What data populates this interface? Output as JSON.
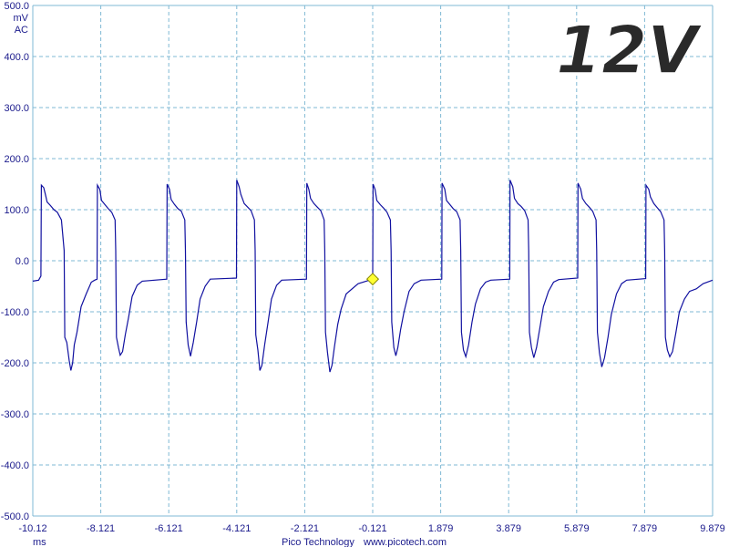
{
  "overlay_label": "12V",
  "footer": {
    "brand": "Pico Technology",
    "url": "www.picotech.com"
  },
  "colors": {
    "trace": "#1111a0",
    "grid": "#7fb8d4",
    "text": "#1a1a8c",
    "marker": "#ffff33",
    "background": "#ffffff"
  },
  "chart_data": {
    "type": "line",
    "title": "",
    "xlabel": "ms",
    "ylabel_lines": [
      "mV",
      "AC"
    ],
    "xlim": [
      -10.121,
      9.879
    ],
    "ylim": [
      -500,
      500
    ],
    "grid": true,
    "x_ticks": [
      "-10.12",
      "-8.121",
      "-6.121",
      "-4.121",
      "-2.121",
      "-0.121",
      "1.879",
      "3.879",
      "5.879",
      "7.879",
      "9.879"
    ],
    "y_ticks": [
      "500.0",
      "400.0",
      "300.0",
      "200.0",
      "100.0",
      "0.0",
      "-100.0",
      "-200.0",
      "-300.0",
      "-400.0",
      "-500.0"
    ],
    "trigger_marker": {
      "x": -0.121,
      "y": -36
    },
    "series": [
      {
        "points": [
          [
            -10.121,
            -40
          ],
          [
            -9.95,
            -38
          ],
          [
            -9.883,
            -30
          ],
          [
            -9.87,
            148
          ],
          [
            -9.8,
            143
          ],
          [
            -9.75,
            130
          ],
          [
            -9.7,
            115
          ],
          [
            -9.6,
            108
          ],
          [
            -9.5,
            100
          ],
          [
            -9.4,
            95
          ],
          [
            -9.28,
            80
          ],
          [
            -9.2,
            20
          ],
          [
            -9.18,
            -150
          ],
          [
            -9.12,
            -160
          ],
          [
            -9.05,
            -195
          ],
          [
            -9.0,
            -215
          ],
          [
            -8.95,
            -200
          ],
          [
            -8.9,
            -165
          ],
          [
            -8.82,
            -140
          ],
          [
            -8.7,
            -90
          ],
          [
            -8.55,
            -65
          ],
          [
            -8.4,
            -42
          ],
          [
            -8.3,
            -38
          ],
          [
            -8.23,
            -36
          ],
          [
            -8.22,
            148
          ],
          [
            -8.15,
            140
          ],
          [
            -8.1,
            118
          ],
          [
            -8.0,
            110
          ],
          [
            -7.9,
            102
          ],
          [
            -7.8,
            95
          ],
          [
            -7.7,
            80
          ],
          [
            -7.68,
            20
          ],
          [
            -7.66,
            -150
          ],
          [
            -7.6,
            -170
          ],
          [
            -7.55,
            -185
          ],
          [
            -7.48,
            -178
          ],
          [
            -7.4,
            -145
          ],
          [
            -7.3,
            -110
          ],
          [
            -7.2,
            -70
          ],
          [
            -7.05,
            -48
          ],
          [
            -6.9,
            -40
          ],
          [
            -6.18,
            -36
          ],
          [
            -6.17,
            150
          ],
          [
            -6.1,
            140
          ],
          [
            -6.05,
            120
          ],
          [
            -5.95,
            110
          ],
          [
            -5.85,
            102
          ],
          [
            -5.75,
            97
          ],
          [
            -5.65,
            80
          ],
          [
            -5.63,
            20
          ],
          [
            -5.61,
            -120
          ],
          [
            -5.55,
            -165
          ],
          [
            -5.48,
            -187
          ],
          [
            -5.4,
            -160
          ],
          [
            -5.3,
            -120
          ],
          [
            -5.2,
            -75
          ],
          [
            -5.05,
            -50
          ],
          [
            -4.9,
            -36
          ],
          [
            -4.13,
            -34
          ],
          [
            -4.12,
            158
          ],
          [
            -4.05,
            145
          ],
          [
            -4.0,
            130
          ],
          [
            -3.9,
            112
          ],
          [
            -3.8,
            105
          ],
          [
            -3.7,
            98
          ],
          [
            -3.6,
            80
          ],
          [
            -3.58,
            20
          ],
          [
            -3.56,
            -145
          ],
          [
            -3.5,
            -175
          ],
          [
            -3.44,
            -215
          ],
          [
            -3.38,
            -205
          ],
          [
            -3.3,
            -165
          ],
          [
            -3.2,
            -120
          ],
          [
            -3.1,
            -75
          ],
          [
            -2.95,
            -48
          ],
          [
            -2.8,
            -38
          ],
          [
            -2.07,
            -36
          ],
          [
            -2.06,
            152
          ],
          [
            -2.0,
            140
          ],
          [
            -1.95,
            122
          ],
          [
            -1.85,
            112
          ],
          [
            -1.75,
            105
          ],
          [
            -1.65,
            98
          ],
          [
            -1.55,
            80
          ],
          [
            -1.53,
            20
          ],
          [
            -1.51,
            -140
          ],
          [
            -1.45,
            -180
          ],
          [
            -1.38,
            -218
          ],
          [
            -1.32,
            -205
          ],
          [
            -1.25,
            -170
          ],
          [
            -1.15,
            -125
          ],
          [
            -1.05,
            -95
          ],
          [
            -0.9,
            -65
          ],
          [
            -0.55,
            -45
          ],
          [
            -0.121,
            -36
          ],
          [
            -0.12,
            -30
          ],
          [
            -0.11,
            150
          ],
          [
            -0.05,
            140
          ],
          [
            0.0,
            118
          ],
          [
            0.1,
            110
          ],
          [
            0.2,
            103
          ],
          [
            0.3,
            95
          ],
          [
            0.4,
            80
          ],
          [
            0.42,
            20
          ],
          [
            0.44,
            -120
          ],
          [
            0.5,
            -170
          ],
          [
            0.56,
            -186
          ],
          [
            0.62,
            -170
          ],
          [
            0.7,
            -135
          ],
          [
            0.8,
            -100
          ],
          [
            0.95,
            -60
          ],
          [
            1.1,
            -45
          ],
          [
            1.3,
            -38
          ],
          [
            1.91,
            -36
          ],
          [
            1.92,
            152
          ],
          [
            2.0,
            140
          ],
          [
            2.05,
            118
          ],
          [
            2.15,
            110
          ],
          [
            2.25,
            102
          ],
          [
            2.35,
            96
          ],
          [
            2.45,
            80
          ],
          [
            2.47,
            20
          ],
          [
            2.49,
            -140
          ],
          [
            2.55,
            -175
          ],
          [
            2.62,
            -188
          ],
          [
            2.7,
            -165
          ],
          [
            2.8,
            -120
          ],
          [
            2.9,
            -85
          ],
          [
            3.05,
            -55
          ],
          [
            3.2,
            -42
          ],
          [
            3.35,
            -38
          ],
          [
            3.91,
            -36
          ],
          [
            3.92,
            158
          ],
          [
            4.0,
            145
          ],
          [
            4.05,
            122
          ],
          [
            4.15,
            112
          ],
          [
            4.25,
            106
          ],
          [
            4.35,
            98
          ],
          [
            4.45,
            80
          ],
          [
            4.47,
            20
          ],
          [
            4.49,
            -140
          ],
          [
            4.55,
            -170
          ],
          [
            4.62,
            -190
          ],
          [
            4.7,
            -170
          ],
          [
            4.8,
            -130
          ],
          [
            4.9,
            -90
          ],
          [
            5.05,
            -60
          ],
          [
            5.2,
            -42
          ],
          [
            5.35,
            -37
          ],
          [
            5.91,
            -34
          ],
          [
            5.92,
            152
          ],
          [
            6.0,
            140
          ],
          [
            6.05,
            122
          ],
          [
            6.15,
            112
          ],
          [
            6.25,
            105
          ],
          [
            6.35,
            97
          ],
          [
            6.45,
            80
          ],
          [
            6.47,
            20
          ],
          [
            6.49,
            -140
          ],
          [
            6.55,
            -180
          ],
          [
            6.62,
            -208
          ],
          [
            6.7,
            -190
          ],
          [
            6.8,
            -150
          ],
          [
            6.9,
            -105
          ],
          [
            7.05,
            -65
          ],
          [
            7.2,
            -45
          ],
          [
            7.35,
            -38
          ],
          [
            7.91,
            -35
          ],
          [
            7.92,
            148
          ],
          [
            8.0,
            140
          ],
          [
            8.05,
            125
          ],
          [
            8.15,
            112
          ],
          [
            8.25,
            104
          ],
          [
            8.35,
            96
          ],
          [
            8.45,
            80
          ],
          [
            8.47,
            20
          ],
          [
            8.49,
            -150
          ],
          [
            8.55,
            -175
          ],
          [
            8.62,
            -188
          ],
          [
            8.7,
            -178
          ],
          [
            8.8,
            -140
          ],
          [
            8.9,
            -100
          ],
          [
            9.05,
            -75
          ],
          [
            9.2,
            -60
          ],
          [
            9.4,
            -55
          ],
          [
            9.6,
            -45
          ],
          [
            9.879,
            -38
          ]
        ]
      }
    ]
  }
}
